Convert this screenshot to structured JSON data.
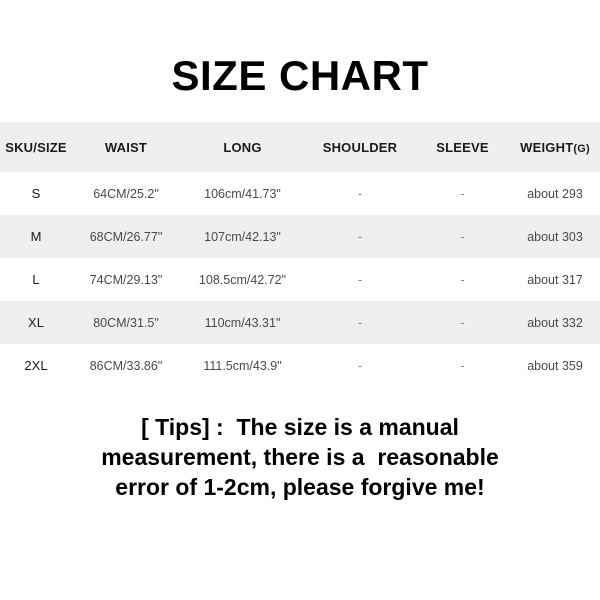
{
  "title": "SIZE CHART",
  "table": {
    "headers": [
      {
        "label": "SKU/SIZE",
        "unit": ""
      },
      {
        "label": "WAIST",
        "unit": ""
      },
      {
        "label": "LONG",
        "unit": ""
      },
      {
        "label": "SHOULDER",
        "unit": ""
      },
      {
        "label": "SLEEVE",
        "unit": ""
      },
      {
        "label": "WEIGHT",
        "unit": "(G)"
      }
    ],
    "rows": [
      {
        "sku": "S",
        "waist": "64CM/25.2\"",
        "long": "106cm/41.73\"",
        "shoulder": "-",
        "sleeve": "-",
        "weight": "about 293"
      },
      {
        "sku": "M",
        "waist": "68CM/26.77\"",
        "long": "107cm/42.13\"",
        "shoulder": "-",
        "sleeve": "-",
        "weight": "about 303"
      },
      {
        "sku": "L",
        "waist": "74CM/29.13\"",
        "long": "108.5cm/42.72\"",
        "shoulder": "-",
        "sleeve": "-",
        "weight": "about 317"
      },
      {
        "sku": "XL",
        "waist": "80CM/31.5\"",
        "long": "110cm/43.31\"",
        "shoulder": "-",
        "sleeve": "-",
        "weight": "about 332"
      },
      {
        "sku": "2XL",
        "waist": "86CM/33.86\"",
        "long": "111.5cm/43.9\"",
        "shoulder": "-",
        "sleeve": "-",
        "weight": "about 359"
      }
    ]
  },
  "tips": {
    "line1": "[ Tips] :  The size is a manual",
    "line2": "measurement, there is a  reasonable",
    "line3": "error of 1-2cm, please forgive me!"
  },
  "colors": {
    "background": "#ffffff",
    "header_band": "#efefef",
    "stripe": "#efefef",
    "title_text": "#000000",
    "body_text": "#4a4a4a",
    "dash_text": "#8a8a8a"
  }
}
